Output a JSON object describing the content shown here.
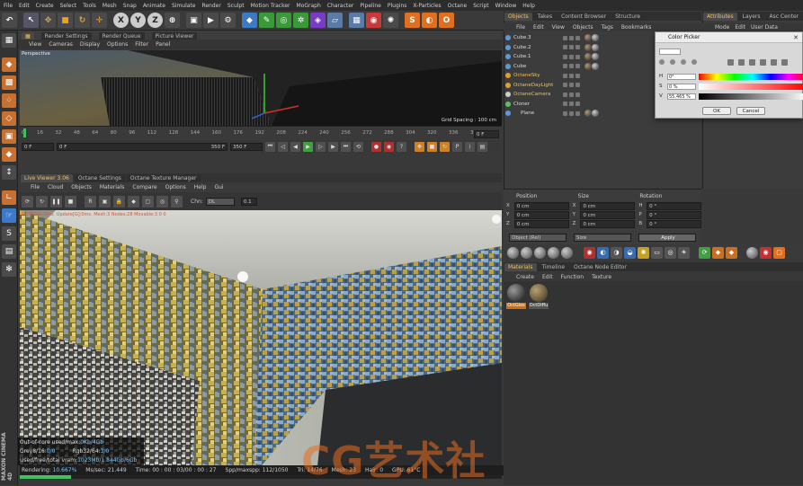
{
  "menu": [
    "File",
    "Edit",
    "Create",
    "Select",
    "Tools",
    "Mesh",
    "Snap",
    "Animate",
    "Simulate",
    "Render",
    "Sculpt",
    "Motion Tracker",
    "MoGraph",
    "Character",
    "Pipeline",
    "Plugins",
    "X-Particles",
    "Octane",
    "Script",
    "Window",
    "Help"
  ],
  "toolbar": {
    "axis_x": "X",
    "axis_y": "Y",
    "axis_z": "Z"
  },
  "viewport": {
    "menu": [
      "View",
      "Cameras",
      "Display",
      "Options",
      "Filter",
      "Panel"
    ],
    "tabs": [
      "Render Settings",
      "Render Queue",
      "Picture Viewer"
    ],
    "name": "Perspective",
    "grid_spacing": "Grid Spacing : 100 cm"
  },
  "timeline": {
    "ticks": [
      "0",
      "16",
      "32",
      "48",
      "64",
      "80",
      "96",
      "112",
      "128",
      "144",
      "160",
      "176",
      "192",
      "208",
      "224",
      "240",
      "256",
      "272",
      "288",
      "304",
      "320",
      "336",
      "35"
    ],
    "end_frame": "0 F",
    "start_field": "0 F",
    "cur_field": "0 F",
    "end_field": "350 F",
    "max_field": "350 F"
  },
  "liveviewer": {
    "tabs": [
      "Live Viewer 3.06",
      "Octane Settings",
      "Octane Texture Manager"
    ],
    "menu": [
      "File",
      "Cloud",
      "Objects",
      "Materials",
      "Compare",
      "Options",
      "Help",
      "Gui"
    ],
    "channel": "DL",
    "value": "0.1",
    "info": "MeshGen:0ms. Update[G]:0ms. Mesh:3 Nodes:28 Movable:3 0 0",
    "stats": {
      "out_of_core_label": "Out-of-core used/max:",
      "out_of_core_value": "0Kb/4Gb",
      "grey_label": "Grey8/16:",
      "grey_value": "0/0",
      "rgb_label": "Rgb32/64:",
      "rgb_value": "3/0",
      "vram_label": "Used/free/total vram:",
      "vram_value": "1023Mb/1.844Gb/6Gb"
    },
    "status": {
      "rendering_label": "Rendering:",
      "rendering_value": "10.667%",
      "mssec_label": "Ms/sec:",
      "mssec_value": "21.449",
      "time_label": "Time:",
      "time_value": "00 : 00 : 03/00 : 00 : 27",
      "spp_label": "Spp/maxspp:",
      "spp_value": "112/1050",
      "tri_label": "Tri:",
      "tri_value": "14/76",
      "mesh_label": "Mesh:",
      "mesh_value": "23",
      "hair_label": "Hair:",
      "hair_value": "0",
      "gpu_label": "GPU:",
      "gpu_value": "61°C"
    },
    "progress": 0.107
  },
  "objects": {
    "tabs": [
      "Objects",
      "Takes",
      "Content Browser",
      "Structure"
    ],
    "menu": [
      "File",
      "Edit",
      "View",
      "Objects",
      "Tags",
      "Bookmarks"
    ],
    "items": [
      {
        "name": "Cube.3",
        "color": "#5a9ad8"
      },
      {
        "name": "Cube.2",
        "color": "#5a9ad8"
      },
      {
        "name": "Cube.1",
        "color": "#5a9ad8"
      },
      {
        "name": "Cube",
        "color": "#5a9ad8"
      },
      {
        "name": "OctaneSky",
        "color": "#e0a030"
      },
      {
        "name": "OctaneDayLight",
        "color": "#e0a030"
      },
      {
        "name": "OctaneCamera",
        "color": "#cccccc"
      },
      {
        "name": "Cloner",
        "color": "#60c060"
      },
      {
        "name": "Plane",
        "color": "#5a9ad8"
      }
    ]
  },
  "coords": {
    "headers": [
      "Position",
      "Size",
      "Rotation"
    ],
    "rows": [
      {
        "axis": "X",
        "pos": "0 cm",
        "size": "0 cm",
        "rot_axis": "H",
        "rot": "0 °"
      },
      {
        "axis": "Y",
        "pos": "0 cm",
        "size": "0 cm",
        "rot_axis": "P",
        "rot": "0 °"
      },
      {
        "axis": "Z",
        "pos": "0 cm",
        "size": "0 cm",
        "rot_axis": "B",
        "rot": "0 °"
      }
    ],
    "mode": "Object (Rel)",
    "size_mode": "Size",
    "apply": "Apply"
  },
  "materials": {
    "tabs": [
      "Materials",
      "Timeline",
      "Octane Node Editor"
    ],
    "menu": [
      "Create",
      "Edit",
      "Function",
      "Texture"
    ],
    "items": [
      {
        "name": "OctGlos",
        "active": true
      },
      {
        "name": "OctDiffu",
        "active": false
      }
    ]
  },
  "attributes": {
    "tabs": [
      "Attributes",
      "Layers",
      "Asc Center"
    ],
    "menu": [
      "Mode",
      "Edit",
      "User Data"
    ]
  },
  "color_picker": {
    "title": "Color Picker",
    "h_label": "H",
    "h_value": "0°",
    "s_label": "S",
    "s_value": "0 %",
    "v_label": "V",
    "v_value": "55.465 %",
    "ok": "OK",
    "cancel": "Cancel"
  },
  "watermark": "CG艺术社",
  "brand": "MAXON CINEMA 4D"
}
